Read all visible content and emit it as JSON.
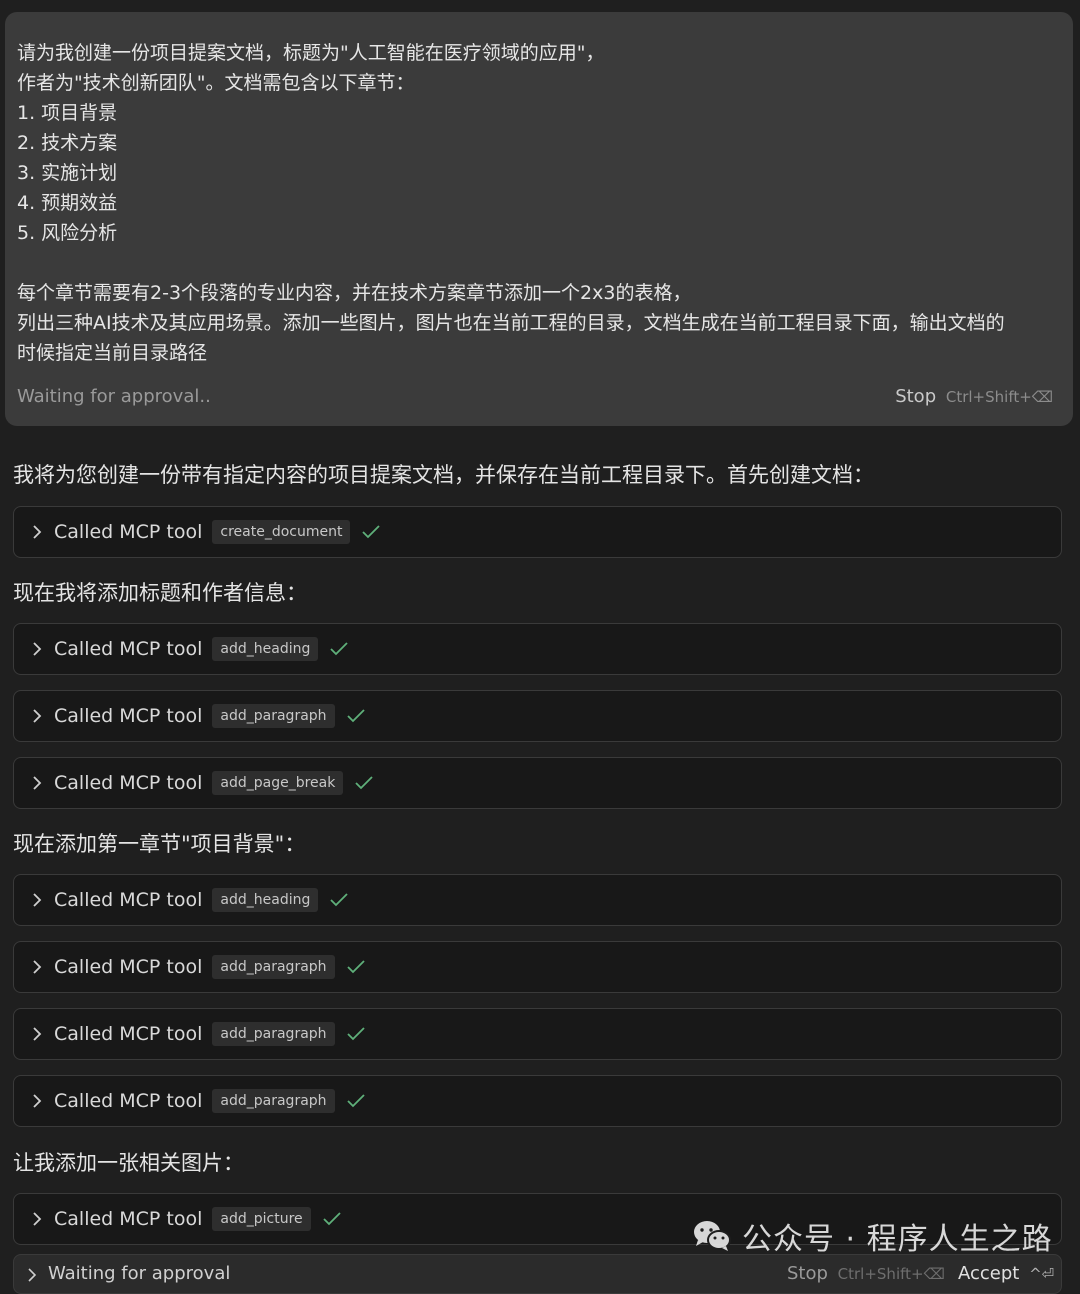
{
  "prompt": {
    "lines": [
      "请为我创建一份项目提案文档，标题为\"人工智能在医疗领域的应用\"，",
      "作者为\"技术创新团队\"。文档需包含以下章节：",
      "1. 项目背景",
      "2. 技术方案",
      "3. 实施计划",
      "4. 预期效益",
      "5. 风险分析",
      "",
      "每个章节需要有2-3个段落的专业内容，并在技术方案章节添加一个2x3的表格，",
      "列出三种AI技术及其应用场景。添加一些图片，图片也在当前工程的目录，文档生成在当前工程目录下面，输出文档的",
      "时候指定当前目录路径"
    ],
    "status": "Waiting for approval..",
    "stop_label": "Stop",
    "stop_shortcut": "Ctrl+Shift+⌫"
  },
  "messages": [
    "我将为您创建一份带有指定内容的项目提案文档，并保存在当前工程目录下。首先创建文档：",
    "现在我将添加标题和作者信息：",
    "现在添加第一章节\"项目背景\"：",
    "让我添加一张相关图片："
  ],
  "tool_label": "Called MCP tool",
  "tools": [
    "create_document",
    "add_heading",
    "add_paragraph",
    "add_page_break",
    "add_heading",
    "add_paragraph",
    "add_paragraph",
    "add_paragraph",
    "add_picture"
  ],
  "bottom_bar": {
    "status": "Waiting for approval",
    "stop_label": "Stop",
    "stop_shortcut": "Ctrl+Shift+⌫",
    "accept_label": "Accept",
    "accept_shortcut": "^⏎"
  },
  "watermark": {
    "text": "公众号 · 程序人生之路",
    "icon": "wechat-icon"
  },
  "colors": {
    "background": "#1f1f1f",
    "prompt_box": "#3b3b3b",
    "tool_card": "#181818",
    "check": "#5fb07a"
  }
}
